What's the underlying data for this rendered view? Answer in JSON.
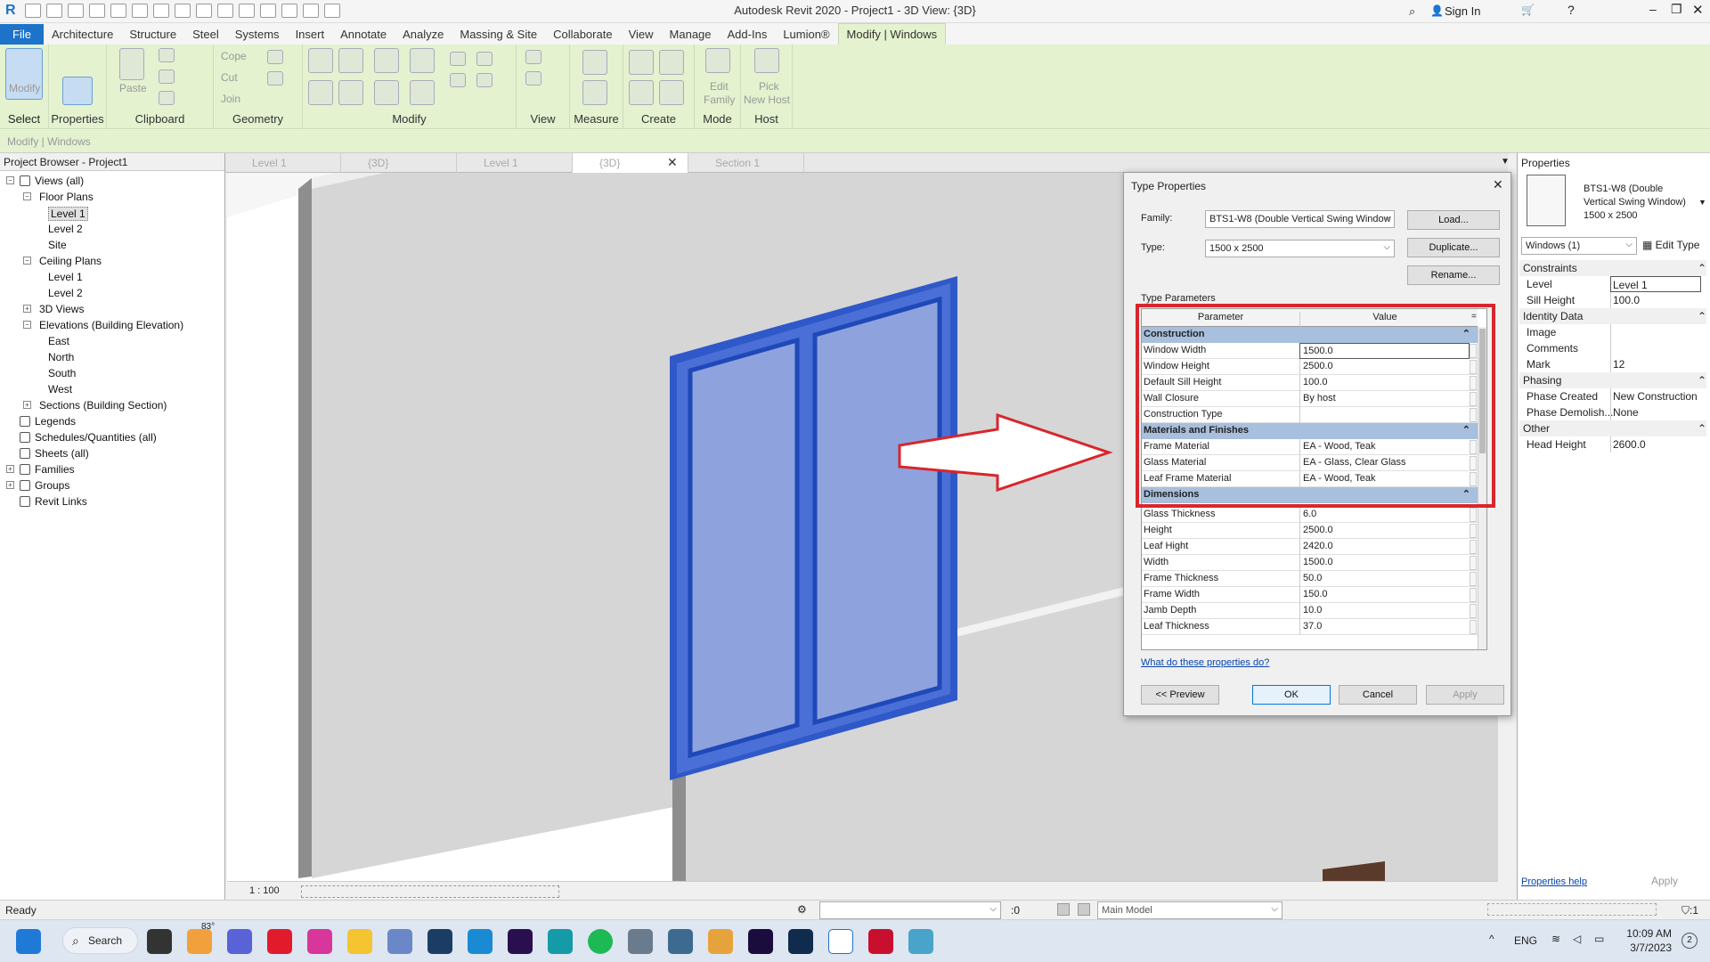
{
  "app": {
    "title": "Autodesk Revit 2020 - Project1 - 3D View: {3D}",
    "sign_in": "Sign In"
  },
  "menu": [
    "File",
    "Architecture",
    "Structure",
    "Steel",
    "Systems",
    "Insert",
    "Annotate",
    "Analyze",
    "Massing & Site",
    "Collaborate",
    "View",
    "Manage",
    "Add-Ins",
    "Lumion®",
    "Modify | Windows"
  ],
  "ribbon": {
    "modify": "Modify",
    "select": "Select",
    "properties": "Properties",
    "clipboard": "Clipboard",
    "paste": "Paste",
    "cope": "Cope",
    "cut": "Cut",
    "join": "Join",
    "geometry": "Geometry",
    "modify_panel": "Modify",
    "view": "View",
    "measure": "Measure",
    "create": "Create",
    "edit_family_1": "Edit",
    "edit_family_2": "Family",
    "mode": "Mode",
    "pick_host_1": "Pick",
    "pick_host_2": "New Host",
    "host": "Host"
  },
  "context_bar": "Modify | Windows",
  "project_browser": {
    "title": "Project Browser - Project1",
    "nodes": [
      {
        "label": "Views (all)"
      },
      {
        "label": "Floor Plans"
      },
      {
        "label": "Level 1"
      },
      {
        "label": "Level 2"
      },
      {
        "label": "Site"
      },
      {
        "label": "Ceiling Plans"
      },
      {
        "label": "Level 1"
      },
      {
        "label": "Level 2"
      },
      {
        "label": "3D Views"
      },
      {
        "label": "Elevations (Building Elevation)"
      },
      {
        "label": "East"
      },
      {
        "label": "North"
      },
      {
        "label": "South"
      },
      {
        "label": "West"
      },
      {
        "label": "Sections (Building Section)"
      },
      {
        "label": "Legends"
      },
      {
        "label": "Schedules/Quantities (all)"
      },
      {
        "label": "Sheets (all)"
      },
      {
        "label": "Families"
      },
      {
        "label": "Groups"
      },
      {
        "label": "Revit Links"
      }
    ]
  },
  "tabs": [
    "Level 1",
    "{3D}",
    "Level 1",
    "{3D}",
    "Section 1"
  ],
  "view_scale": "1 : 100",
  "dialog": {
    "title": "Type Properties",
    "family_label": "Family:",
    "family_value": "BTS1-W8 (Double Vertical Swing Window",
    "type_label": "Type:",
    "type_value": "1500 x 2500",
    "load": "Load...",
    "duplicate": "Duplicate...",
    "rename": "Rename...",
    "type_parameters": "Type Parameters",
    "col_parameter": "Parameter",
    "col_value": "Value",
    "group_construction": "Construction",
    "construction_rows": [
      {
        "p": "Window Width",
        "v": "1500.0"
      },
      {
        "p": "Window Height",
        "v": "2500.0"
      },
      {
        "p": "Default Sill Height",
        "v": "100.0"
      },
      {
        "p": "Wall Closure",
        "v": "By host"
      },
      {
        "p": "Construction Type",
        "v": ""
      }
    ],
    "group_materials": "Materials and Finishes",
    "materials_rows": [
      {
        "p": "Frame Material",
        "v": "EA - Wood, Teak"
      },
      {
        "p": "Glass Material",
        "v": "EA - Glass, Clear Glass"
      },
      {
        "p": "Leaf Frame Material",
        "v": "EA - Wood, Teak"
      }
    ],
    "group_dimensions": "Dimensions",
    "dimension_rows": [
      {
        "p": "Glass Thickness",
        "v": "6.0"
      },
      {
        "p": "Height",
        "v": "2500.0"
      },
      {
        "p": "Leaf Hight",
        "v": "2420.0"
      },
      {
        "p": "Width",
        "v": "1500.0"
      },
      {
        "p": "Frame Thickness",
        "v": "50.0"
      },
      {
        "p": "Frame Width",
        "v": "150.0"
      },
      {
        "p": "Jamb Depth",
        "v": "10.0"
      },
      {
        "p": "Leaf Thickness",
        "v": "37.0"
      }
    ],
    "help_link": "What do these properties do?",
    "preview": "<< Preview",
    "ok": "OK",
    "cancel": "Cancel",
    "apply": "Apply"
  },
  "properties": {
    "title": "Properties",
    "type_name_1": "BTS1-W8 (Double",
    "type_name_2": "Vertical Swing Window)",
    "type_name_3": "1500 x 2500",
    "selector": "Windows (1)",
    "edit_type": "Edit Type",
    "groups": [
      {
        "name": "Constraints",
        "rows": [
          {
            "k": "Level",
            "v": "Level 1"
          },
          {
            "k": "Sill Height",
            "v": "100.0"
          }
        ]
      },
      {
        "name": "Identity Data",
        "rows": [
          {
            "k": "Image",
            "v": ""
          },
          {
            "k": "Comments",
            "v": ""
          },
          {
            "k": "Mark",
            "v": "12"
          }
        ]
      },
      {
        "name": "Phasing",
        "rows": [
          {
            "k": "Phase Created",
            "v": "New Construction"
          },
          {
            "k": "Phase Demolish...",
            "v": "None"
          }
        ]
      },
      {
        "name": "Other",
        "rows": [
          {
            "k": "Head Height",
            "v": "2600.0"
          }
        ]
      }
    ],
    "help": "Properties help",
    "apply": "Apply"
  },
  "status": {
    "text": "Ready",
    "zero": ":0",
    "workset": "Main Model",
    "filter": ":1"
  },
  "taskbar": {
    "temp": "83°",
    "search": "Search",
    "lang": "ENG",
    "time": "10:09 AM",
    "date": "3/7/2023"
  },
  "colors": {
    "ribbon": "#e4f2cf",
    "file_blue": "#1c73c9",
    "highlight_red": "#d8262c",
    "window_blue": "#2f58c9",
    "group_blue": "#a8bfdd"
  }
}
